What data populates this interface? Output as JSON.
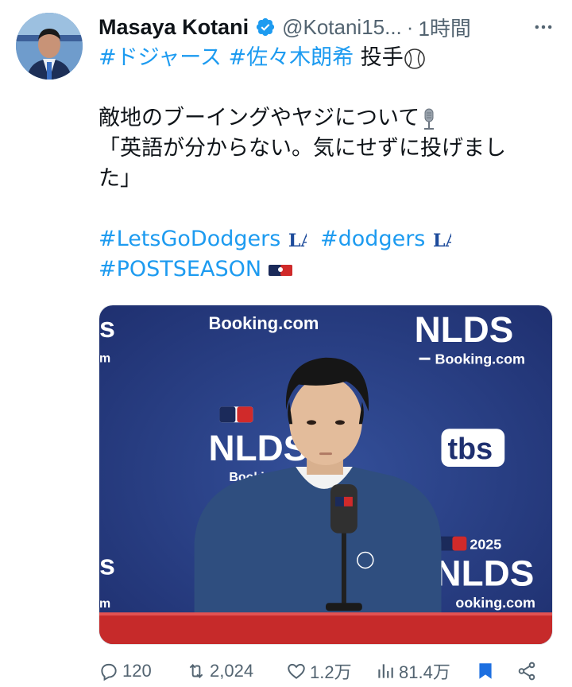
{
  "user": {
    "name": "Masaya Kotani",
    "handle": "@Kotani15...",
    "separator": "·",
    "time": "1時間"
  },
  "tweet": {
    "tag_dodgers_jp": "#ドジャース",
    "tag_sasaki": "#佐々木朗希",
    "role": "投手",
    "line2": "敵地のブーイングやヤジについて",
    "line3": "「英語が分からない。気にせずに投げまし",
    "line4": "た」",
    "tag_letsgo": "#LetsGoDodgers",
    "tag_dodgers": "#dodgers",
    "tag_postseason": "#POSTSEASON"
  },
  "media": {
    "backdrop_sponsor": "Booking.com",
    "backdrop_series": "NLDS",
    "backdrop_sponsor_small": "Booking.com",
    "backdrop_year": "2025",
    "backdrop_network": "tbs",
    "backdrop_partial_left": "Booki",
    "backdrop_partial_right": "ooking.com"
  },
  "actions": {
    "replies": "120",
    "reposts": "2,024",
    "likes": "1.2万",
    "views": "81.4万"
  },
  "colors": {
    "link": "#1d9bf0",
    "muted": "#536471",
    "bookmark": "#1d6fe0",
    "backdrop": "#2a3f86"
  },
  "icons": [
    "verified-badge-icon",
    "more-icon",
    "baseball-icon",
    "microphone-icon",
    "la-logo-icon",
    "mlb-logo-icon",
    "reply-icon",
    "repost-icon",
    "like-icon",
    "views-icon",
    "bookmark-icon",
    "share-icon"
  ]
}
